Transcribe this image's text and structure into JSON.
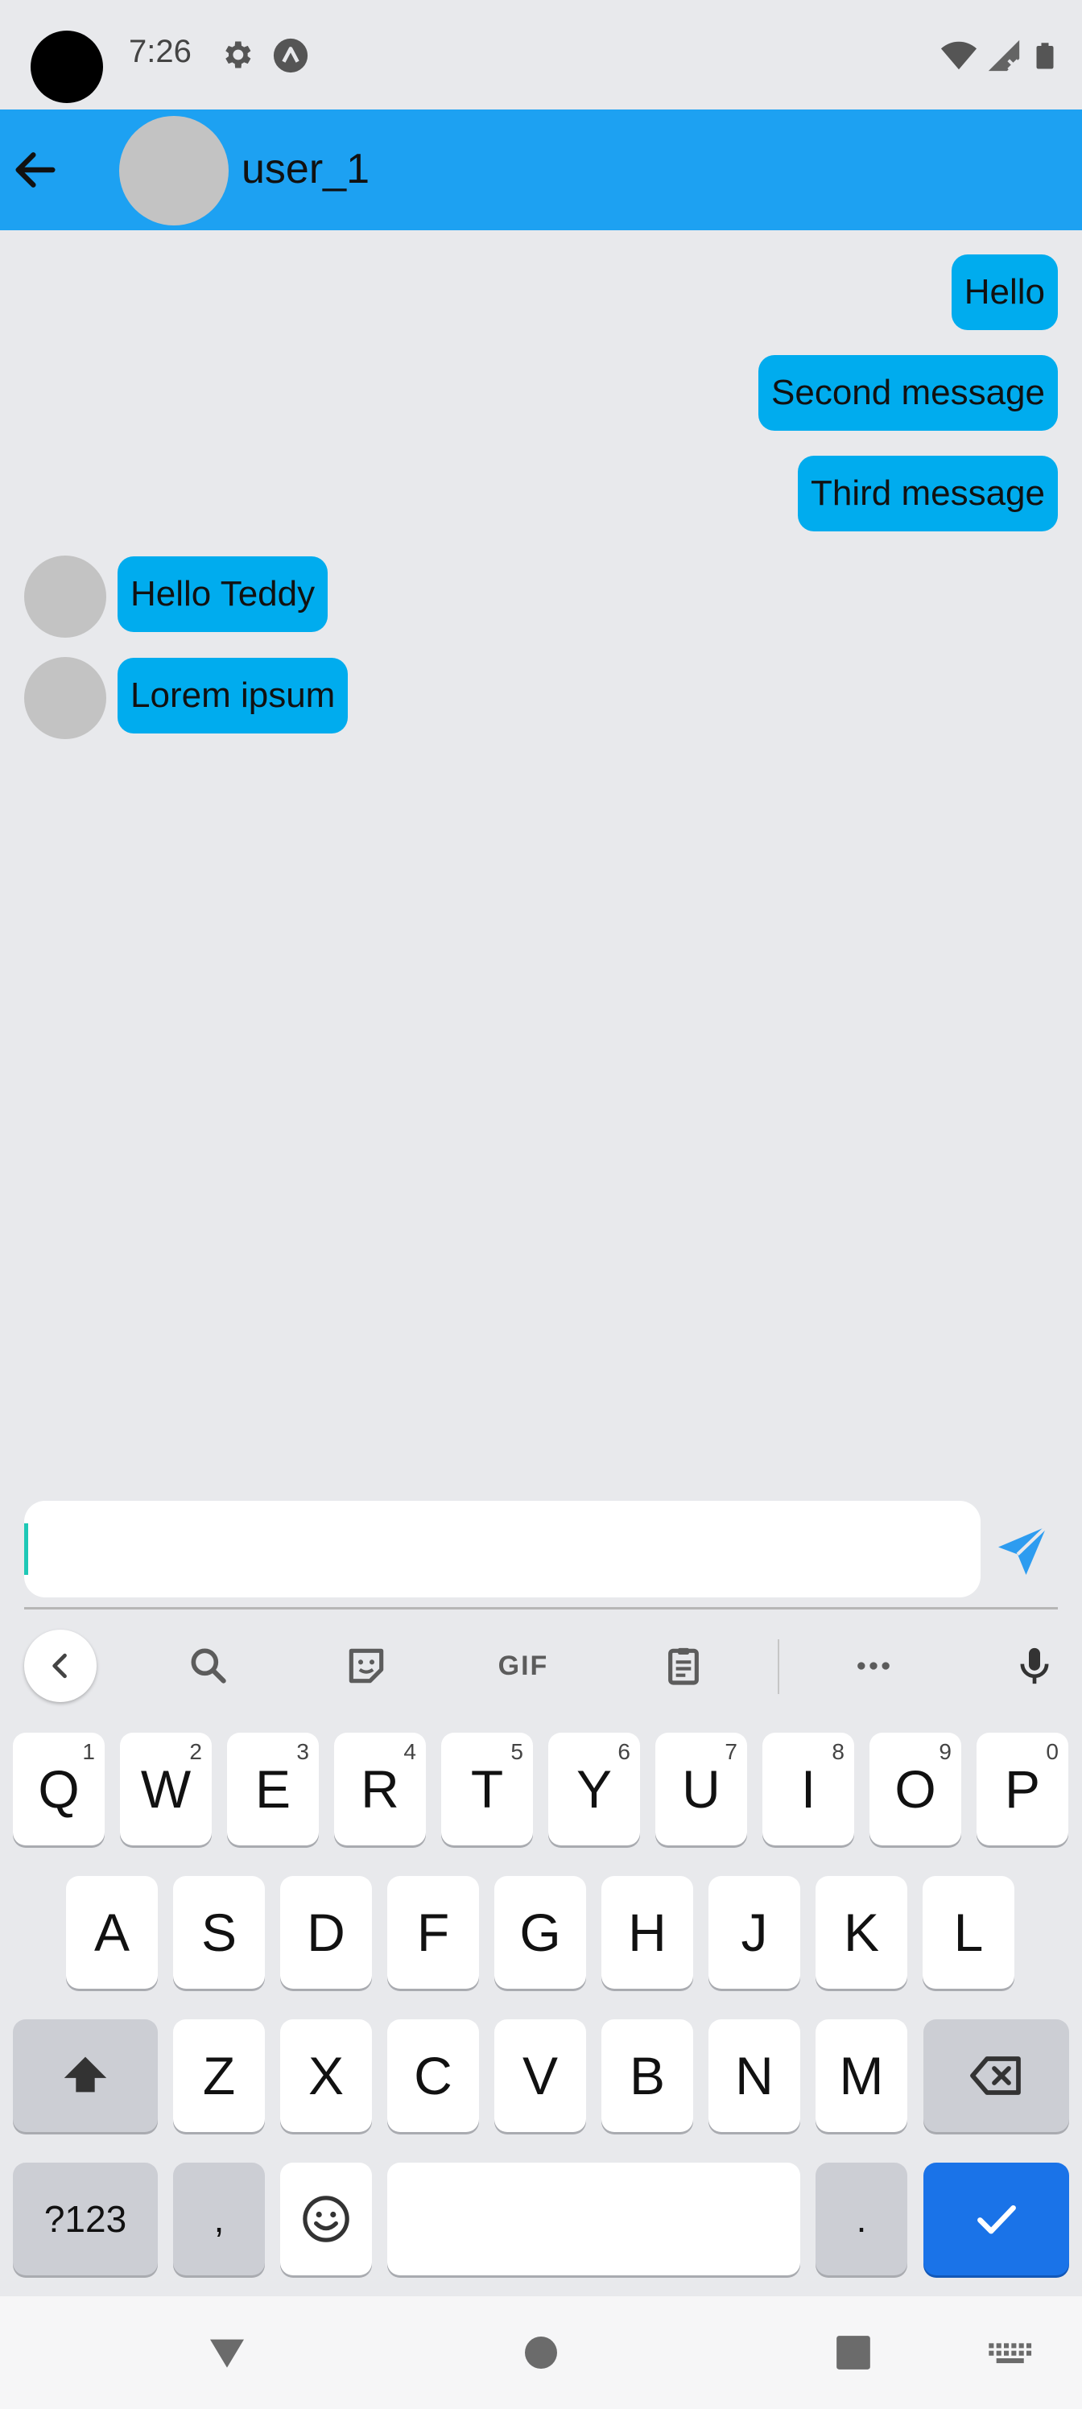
{
  "status_bar": {
    "time": "7:26"
  },
  "app_bar": {
    "title": "user_1"
  },
  "messages": [
    {
      "text": "Hello",
      "direction": "outgoing"
    },
    {
      "text": "Second message",
      "direction": "outgoing"
    },
    {
      "text": "Third message",
      "direction": "outgoing"
    },
    {
      "text": "Hello Teddy",
      "direction": "incoming"
    },
    {
      "text": "Lorem ipsum",
      "direction": "incoming"
    }
  ],
  "composer": {
    "value": ""
  },
  "keyboard": {
    "toolbar": {
      "gif_label": "GIF"
    },
    "rows": [
      [
        {
          "label": "Q",
          "hint": "1"
        },
        {
          "label": "W",
          "hint": "2"
        },
        {
          "label": "E",
          "hint": "3"
        },
        {
          "label": "R",
          "hint": "4"
        },
        {
          "label": "T",
          "hint": "5"
        },
        {
          "label": "Y",
          "hint": "6"
        },
        {
          "label": "U",
          "hint": "7"
        },
        {
          "label": "I",
          "hint": "8"
        },
        {
          "label": "O",
          "hint": "9"
        },
        {
          "label": "P",
          "hint": "0"
        }
      ],
      [
        {
          "label": "A"
        },
        {
          "label": "S"
        },
        {
          "label": "D"
        },
        {
          "label": "F"
        },
        {
          "label": "G"
        },
        {
          "label": "H"
        },
        {
          "label": "J"
        },
        {
          "label": "K"
        },
        {
          "label": "L"
        }
      ],
      [
        {
          "label": "Z"
        },
        {
          "label": "X"
        },
        {
          "label": "C"
        },
        {
          "label": "V"
        },
        {
          "label": "B"
        },
        {
          "label": "N"
        },
        {
          "label": "M"
        }
      ]
    ],
    "bottom_row": {
      "symbols_label": "?123",
      "comma_label": ",",
      "period_label": "."
    }
  },
  "colors": {
    "app_bar": "#1da1f2",
    "bubble": "#00acee",
    "background": "#e8e9ec",
    "enter_key": "#1a73e8"
  }
}
